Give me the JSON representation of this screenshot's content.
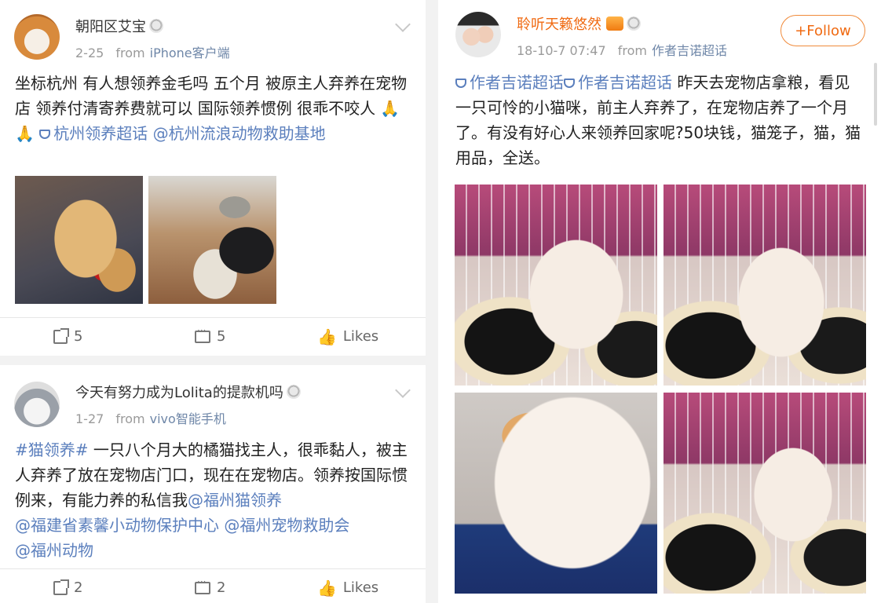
{
  "posts": [
    {
      "user": "朝阳区艾宝",
      "date": "2-25",
      "from": "from",
      "source": "iPhone客户端",
      "text_plain": "坐标杭州 有人想领养金毛吗 五个月 被原主人弃养在宠物店 领养付清寄养费就可以 国际领养惯例 很乖不咬人 🙏🙏 ",
      "topic": "杭州领养超话",
      "mention": "@杭州流浪动物救助基地",
      "images": [
        "golden-retriever-photo",
        "puppy-play-photo"
      ],
      "reposts": "5",
      "comments": "5",
      "likes": "Likes"
    },
    {
      "user": "今天有努力成为Lolita的提款机吗",
      "date": "1-27",
      "from": "from",
      "source": "vivo智能手机",
      "hashtag": "#猫领养#",
      "text_plain": " 一只八个月大的橘猫找主人，很乖黏人，被主人弃养了放在宠物店门口，现在在宠物店。领养按国际惯例来，有能力养的私信我",
      "mention1": "@福州猫领养",
      "mention2": "@福建省素馨小动物保护中心",
      "mention3": "@福州宠物救助会",
      "mention4": "@福州动物",
      "reposts": "2",
      "comments": "2",
      "likes": "Likes"
    },
    {
      "user": "聆听天籁悠然",
      "date": "18-10-7 07:47",
      "from": "from",
      "source": "作者吉诺超话",
      "follow": "+Follow",
      "topic1": "作者吉诺超话",
      "topic2": "作者吉诺超话",
      "text_plain": " 昨天去宠物店拿粮，看见一只可怜的小猫咪，前主人弃养了，在宠物店养了一个月了。有没有好心人来领养回家呢?50块钱，猫笼子，猫，猫用品，全送。",
      "images": [
        "kitten-photo-1",
        "kitten-photo-2",
        "kitten-photo-3",
        "kitten-photo-4"
      ]
    }
  ],
  "colors": {
    "link": "#5b7fbd",
    "orange": "#f06a12",
    "meta": "#9a9a9a",
    "bg": "#f2f2f2"
  }
}
